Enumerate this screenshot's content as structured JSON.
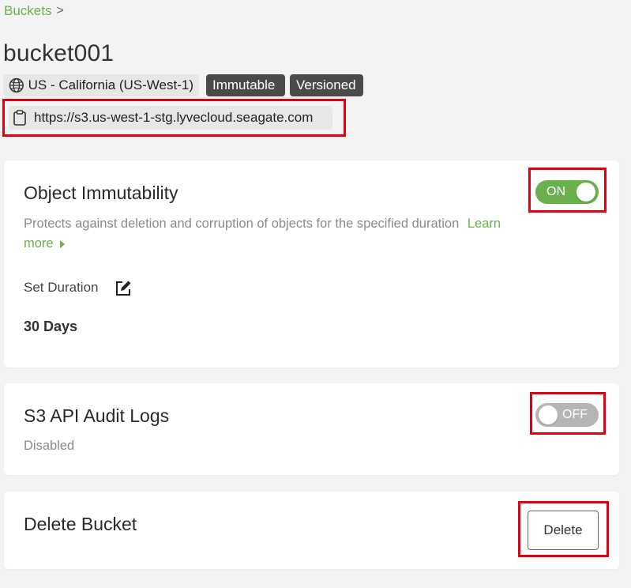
{
  "breadcrumb": {
    "link": "Buckets",
    "separator": ">"
  },
  "bucket": {
    "name": "bucket001",
    "region": "US - California (US-West-1)",
    "badges": [
      "Immutable",
      "Versioned"
    ],
    "endpoint_url": "https://s3.us-west-1-stg.lyvecloud.seagate.com"
  },
  "immutability": {
    "title": "Object Immutability",
    "toggle_label": "ON",
    "enabled": true,
    "description": "Protects against deletion and corruption of objects for the specified duration",
    "learn_more_part1": "Learn",
    "learn_more_part2": "more",
    "duration_label": "Set Duration",
    "duration_value": "30 Days"
  },
  "audit_logs": {
    "title": "S3 API Audit Logs",
    "toggle_label": "OFF",
    "enabled": false,
    "status": "Disabled"
  },
  "delete_section": {
    "title": "Delete Bucket",
    "button_label": "Delete"
  },
  "colors": {
    "accent": "#6ab04c",
    "highlight": "#e1000f",
    "badge_bg": "#4a4a4a"
  }
}
